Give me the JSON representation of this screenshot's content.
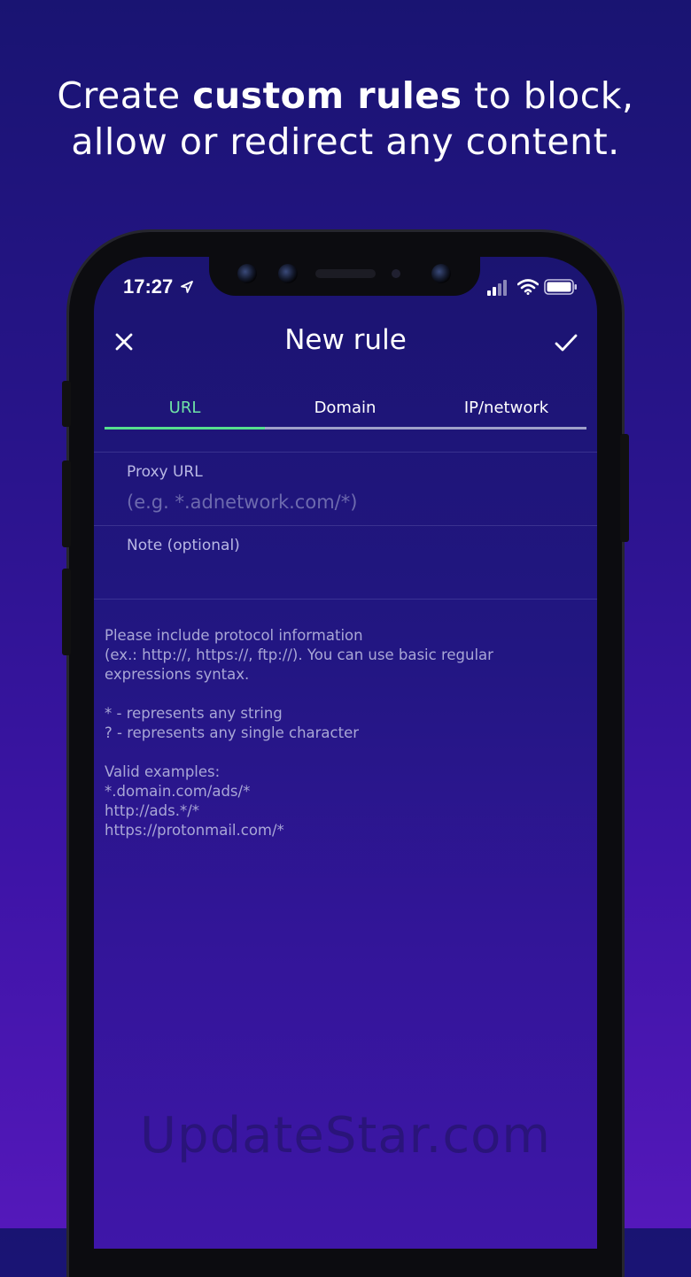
{
  "headline": {
    "part1": "Create ",
    "bold": "custom rules",
    "part2": " to block,",
    "line2": "allow or redirect any content."
  },
  "status_bar": {
    "time": "17:27",
    "icons": [
      "location-arrow-icon",
      "cellular-signal-icon",
      "wifi-icon",
      "battery-icon"
    ]
  },
  "nav": {
    "title": "New rule",
    "close_icon": "close-icon",
    "confirm_icon": "checkmark-icon"
  },
  "tabs": [
    {
      "label": "URL",
      "active": true
    },
    {
      "label": "Domain",
      "active": false
    },
    {
      "label": "IP/network",
      "active": false
    }
  ],
  "form": {
    "proxy_url": {
      "label": "Proxy URL",
      "placeholder": "(e.g. *.adnetwork.com/*)",
      "value": ""
    },
    "note": {
      "label": "Note (optional)",
      "value": ""
    }
  },
  "help": {
    "intro": [
      "Please include protocol information",
      "(ex.: http://, https://, ftp://). You can use basic regular",
      "expressions syntax."
    ],
    "rules": [
      "* - represents any string",
      "? - represents any single character"
    ],
    "examples_title": "Valid examples:",
    "examples": [
      "*.domain.com/ads/*",
      "http://ads.*/*",
      "https://protonmail.com/*"
    ]
  },
  "watermark": "UpdateStar.com",
  "colors": {
    "accent_active_tab": "#6fe3a6",
    "tab_indicator": "#56e08e",
    "background_top": "#191472",
    "background_bottom": "#5418ba"
  }
}
